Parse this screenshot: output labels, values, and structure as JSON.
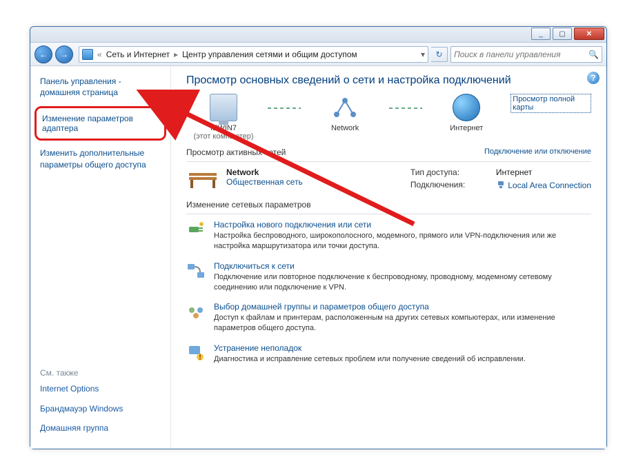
{
  "titlebar": {
    "min": "_",
    "max": "▢",
    "close": "✕"
  },
  "nav": {
    "back": "←",
    "fwd": "→",
    "breadcrumb_prefix": "«",
    "crumb1": "Сеть и Интернет",
    "crumb2": "Центр управления сетями и общим доступом",
    "chevron": "▸",
    "dropdown": "▾",
    "refresh": "↻",
    "search_placeholder": "Поиск в панели управления",
    "search_icon": "🔍"
  },
  "sidebar": {
    "home": "Панель управления - домашняя страница",
    "highlight": "Изменение параметров адаптера",
    "advanced": "Изменить дополнительные параметры общего доступа",
    "see_also_title": "См. также",
    "see_also": {
      "internet_options": "Internet Options",
      "firewall": "Брандмауэр Windows",
      "homegroup": "Домашняя группа"
    }
  },
  "content": {
    "help": "?",
    "heading": "Просмотр основных сведений о сети и настройка подключений",
    "map": {
      "this_pc": "IEWIN7",
      "this_pc_sub": "(этот компьютер)",
      "network": "Network",
      "internet": "Интернет",
      "full_map": "Просмотр полной карты"
    },
    "active_section": "Просмотр активных сетей",
    "connect_link": "Подключение или отключение",
    "network_block": {
      "name": "Network",
      "type": "Общественная сеть",
      "access_label": "Тип доступа:",
      "access_value": "Интернет",
      "conn_label": "Подключения:",
      "conn_value": "Local Area Connection"
    },
    "change_section": "Изменение сетевых параметров",
    "tasks": [
      {
        "icon": "plug",
        "label": "Настройка нового подключения или сети",
        "desc": "Настройка беспроводного, широкополосного, модемного, прямого или VPN-подключения или же настройка маршрутизатора или точки доступа."
      },
      {
        "icon": "cable",
        "label": "Подключиться к сети",
        "desc": "Подключение или повторное подключение к беспроводному, проводному, модемному сетевому соединению или подключение к VPN."
      },
      {
        "icon": "home",
        "label": "Выбор домашней группы и параметров общего доступа",
        "desc": "Доступ к файлам и принтерам, расположенным на других сетевых компьютерах, или изменение параметров общего доступа."
      },
      {
        "icon": "diag",
        "label": "Устранение неполадок",
        "desc": "Диагностика и исправление сетевых проблем или получение сведений об исправлении."
      }
    ]
  }
}
